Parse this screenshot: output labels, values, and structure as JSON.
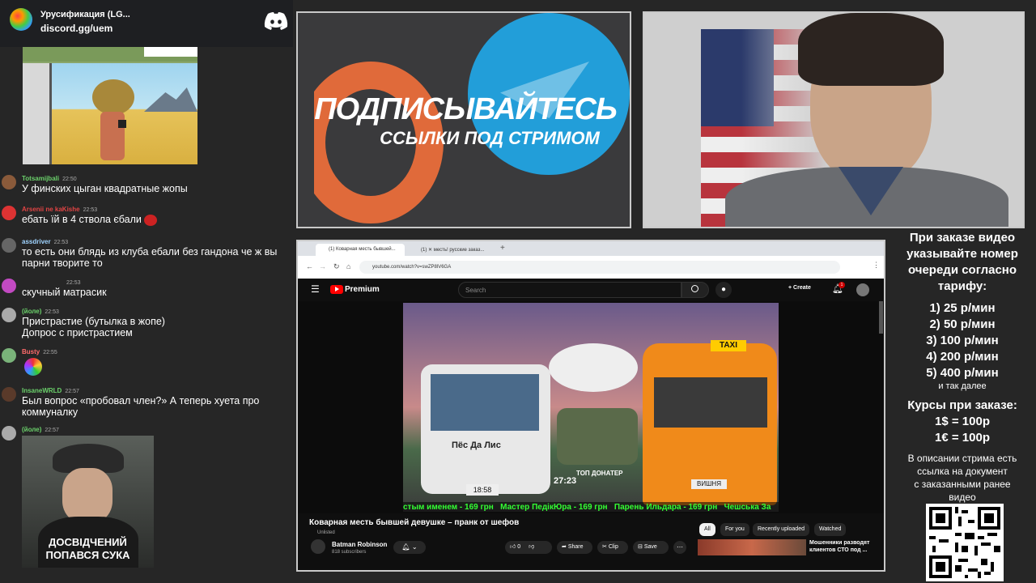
{
  "discord": {
    "server_name": "Урусификация (LG...",
    "invite": "discord.gg/uem",
    "brand_color": "#5865f2"
  },
  "chat": {
    "messages": [
      {
        "user": "Totsamijbali",
        "time": "22:50",
        "name_color": "#6bd16b",
        "text": "У финских цыган квадратные жопы"
      },
      {
        "user": "Arsenii ne kaKishe",
        "time": "22:53",
        "name_color": "#e04444",
        "text": "ебать їй в 4 ствола єбали"
      },
      {
        "user": "assdriver",
        "time": "22:53",
        "name_color": "#9fd3ff",
        "text": "то есть они блядь из клуба ебали без гандона че ж вы парни творите то"
      },
      {
        "user": "",
        "time": "22:53",
        "name_color": "#cfcfcf",
        "text": "скучный матрасик"
      },
      {
        "user": "(йоле)",
        "time": "22:53",
        "name_color": "#6bd16b",
        "text": "Пристрастие (бутылка в жопе) Допрос с пристрастием"
      },
      {
        "user": "Busty",
        "time": "22:55",
        "name_color": "#ff6b6b",
        "text": ""
      },
      {
        "user": "InsaneWRLD",
        "time": "22:57",
        "name_color": "#6bd16b",
        "text": "Был вопрос «пробовал член?» А теперь хуета про коммуналку"
      },
      {
        "user": "(йоле)",
        "time": "22:57",
        "name_color": "#6bd16b",
        "text": ""
      }
    ],
    "meme_caption_line1": "ДОСВІДЧЕНИЙ",
    "meme_caption_line2": "ПОПАВСЯ СУКА"
  },
  "promo": {
    "title": "ПОДПИСЫВАЙТЕСЬ",
    "subtitle": "ССЫЛКИ ПОД СТРИМОМ",
    "boosty_color": "#e06a3a",
    "telegram_color": "#229ed9"
  },
  "browser": {
    "tab1": "(1) Коварная месть бывшей...",
    "tab2": "(1) ✕ месть! русские заказ...",
    "url": "youtube.com/watch?v=swZP8lV6GA"
  },
  "youtube": {
    "logo": "Premium",
    "search_placeholder": "Search",
    "create_label": "Create",
    "notif_count": "1",
    "video_title": "Коварная месть бывшей девушке – пранк от шефов",
    "unlisted": "Unlisted",
    "channel": "Batman Robinson",
    "subscribers": "818 subscribers",
    "likes": "0",
    "share": "Share",
    "clip": "Clip",
    "save": "Save",
    "chips": [
      "All",
      "For you",
      "Recently uploaded",
      "Watched"
    ],
    "rec_title": "Мошенники разводят клиентов СТО под ...",
    "overlay": {
      "van_left_label": "Пёс Да Лис",
      "van_right_label": "ВИШНЯ",
      "taxi": "TAXI",
      "time_left": "18:58",
      "duration": "27:23",
      "top_donator": "ТОП ДОНАТЕР",
      "ticker": "стым именем - 169 грн   Мастер ПедікЮра - 169 грн   Парень Ильдара - 169 грн   Чешська За"
    }
  },
  "pricing": {
    "intro": [
      "При заказе видео",
      "указывайте номер",
      "очереди согласно",
      "тарифу:"
    ],
    "tiers": [
      "1) 25 р/мин",
      "2) 50 р/мин",
      "3) 100 р/мин",
      "4) 200 р/мин",
      "5) 400 р/мин"
    ],
    "etc": "и так далее",
    "rates_title": "Курсы при заказе:",
    "rates": [
      "1$ = 100р",
      "1€ = 100р"
    ],
    "note": [
      "В описании стрима есть",
      "ссылка на документ",
      "с заказанными ранее",
      "видео"
    ]
  }
}
